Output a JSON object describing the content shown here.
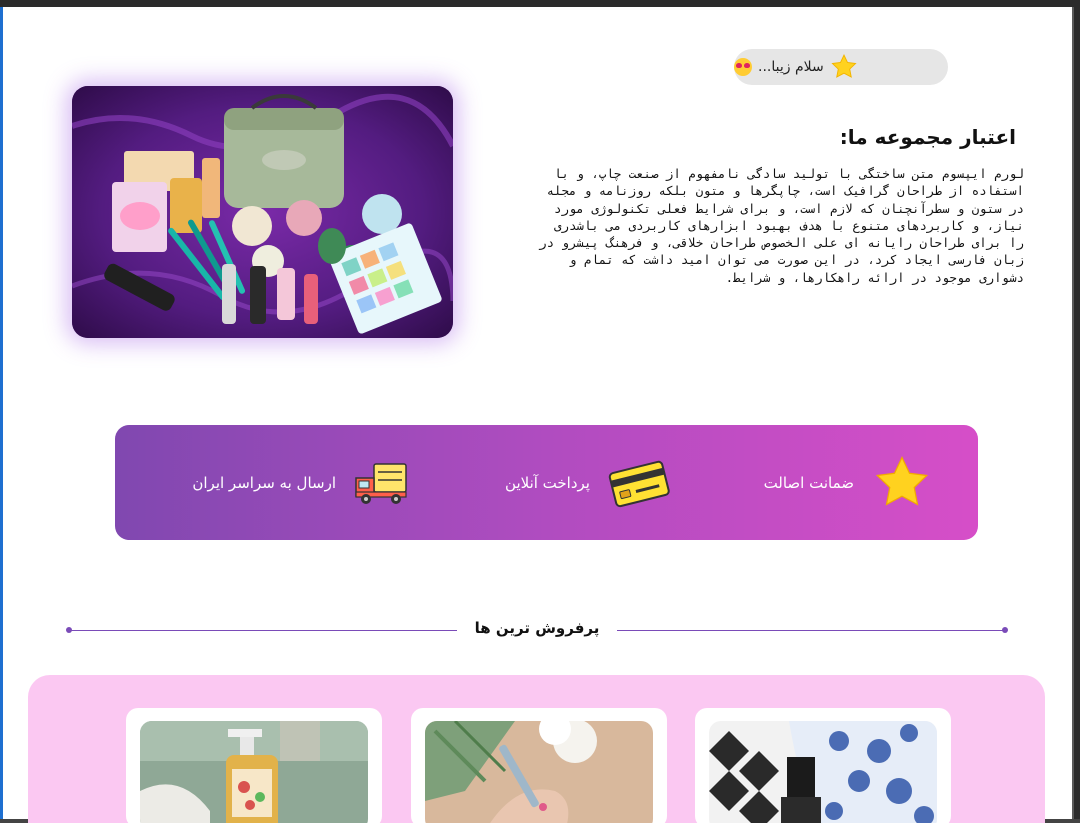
{
  "greeting": {
    "text": "سلام زیبا...",
    "icon": "star-icon",
    "emoji": "heart-eyes-emoji"
  },
  "hero": {
    "image": "cosmetics-collection-photo"
  },
  "about": {
    "title": "اعتبار مجموعه ما:",
    "text": "لورم  ایپسوم متن ساختگی با تولید سادگی نامفهوم از صنعت چاپ، و با استفاده از  طراحان گرافیک است، چاپگرها و متون بلکه روزنامه و مجله در ستون و  سطرآنچنان که لازم است، و برای شرایط فعلی تکنولوژی مورد نیاز، و کاربردهای  متنوع با هدف بهبود ابزارهای کاربردی می باشدری را برای طراحان رایانه ای علی الخصوص طراحان خلاقی، و فرهنگ پیشرو در زبان فارسی ایجاد کرد، در این صورت می توان امید  داشت که تمام و دشواری موجود در ارائه راهکارها، و شرایط."
  },
  "features": {
    "items": [
      {
        "label": "ضمانت اصالت",
        "icon": "star-icon"
      },
      {
        "label": "پرداخت آنلاین",
        "icon": "credit-card-icon"
      },
      {
        "label": "ارسال به سراسر ایران",
        "icon": "delivery-truck-icon"
      }
    ],
    "gradient": [
      "#8048b0",
      "#d64ec8"
    ]
  },
  "bestsellers": {
    "title": "پرفروش ترین ها",
    "background": "#fbc8f2",
    "products": [
      {
        "image": "lotion-bottle-photo"
      },
      {
        "image": "makeup-brush-photo"
      },
      {
        "image": "perfume-bottle-photo"
      }
    ]
  }
}
